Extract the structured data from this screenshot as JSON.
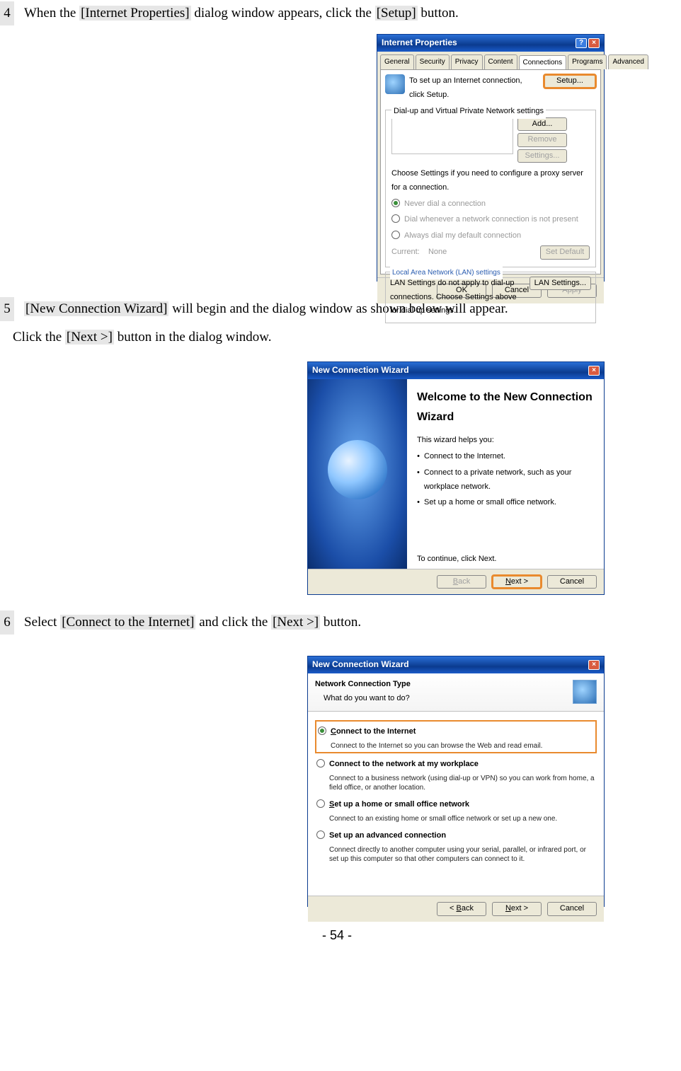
{
  "steps": {
    "s4": {
      "num": "4",
      "pre": "When the ",
      "b1": "[Internet Properties]",
      "mid": " dialog window appears, click the ",
      "b2": "[Setup]",
      "post": " button."
    },
    "s5": {
      "num": "5",
      "pre2": " ",
      "b1": "[New Connection Wizard]",
      "mid": " will begin and the dialog window as shown below will appear.",
      "line2a": "Click the ",
      "b2": "[Next >]",
      "line2b": " button in the dialog window."
    },
    "s6": {
      "num": "6",
      "pre": "Select ",
      "b1": "[Connect to the Internet]",
      "mid": " and click the ",
      "b2": "[Next >]",
      "post": " button."
    }
  },
  "fig1": {
    "title": "Internet Properties",
    "tabs": [
      "General",
      "Security",
      "Privacy",
      "Content",
      "Connections",
      "Programs",
      "Advanced"
    ],
    "setup_text": "To set up an Internet connection, click Setup.",
    "btn_setup": "Setup...",
    "vpn_legend": "Dial-up and Virtual Private Network settings",
    "btn_add": "Add...",
    "btn_remove": "Remove",
    "btn_settings": "Settings...",
    "proxy_text": "Choose Settings if you need to configure a proxy server for a connection.",
    "r1": "Never dial a connection",
    "r2": "Dial whenever a network connection is not present",
    "r3": "Always dial my default connection",
    "cur_lbl": "Current:",
    "cur_val": "None",
    "btn_setdef": "Set Default",
    "lan_legend": "Local Area Network (LAN) settings",
    "lan_text": "LAN Settings do not apply to dial-up connections. Choose Settings above for dial-up settings.",
    "btn_lan": "LAN Settings...",
    "ok": "OK",
    "cancel": "Cancel",
    "apply": "Apply"
  },
  "fig2": {
    "title": "New Connection Wizard",
    "h": "Welcome to the New Connection Wizard",
    "helps": "This wizard helps you:",
    "b1": "Connect to the Internet.",
    "b2": "Connect to a private network, such as your workplace network.",
    "b3": "Set up a home or small office network.",
    "cont": "To continue, click Next.",
    "back": "< Back",
    "next": "Next >",
    "cancel": "Cancel"
  },
  "fig3": {
    "title": "New Connection Wizard",
    "h": "Network Connection Type",
    "sub": "What do you want to do?",
    "o1l": "Connect to the Internet",
    "o1d": "Connect to the Internet so you can browse the Web and read email.",
    "o2l": "Connect to the network at my workplace",
    "o2d": "Connect to a business network (using dial-up or VPN) so you can work from home, a field office, or another location.",
    "o3l": "Set up a home or small office network",
    "o3d": "Connect to an existing home or small office network or set up a new one.",
    "o4l": "Set up an advanced connection",
    "o4d": "Connect directly to another computer using your serial, parallel, or infrared port, or set up this computer so that other computers can connect to it.",
    "back": "< Back",
    "next": "Next >",
    "cancel": "Cancel"
  },
  "page_number": "- 54 -"
}
